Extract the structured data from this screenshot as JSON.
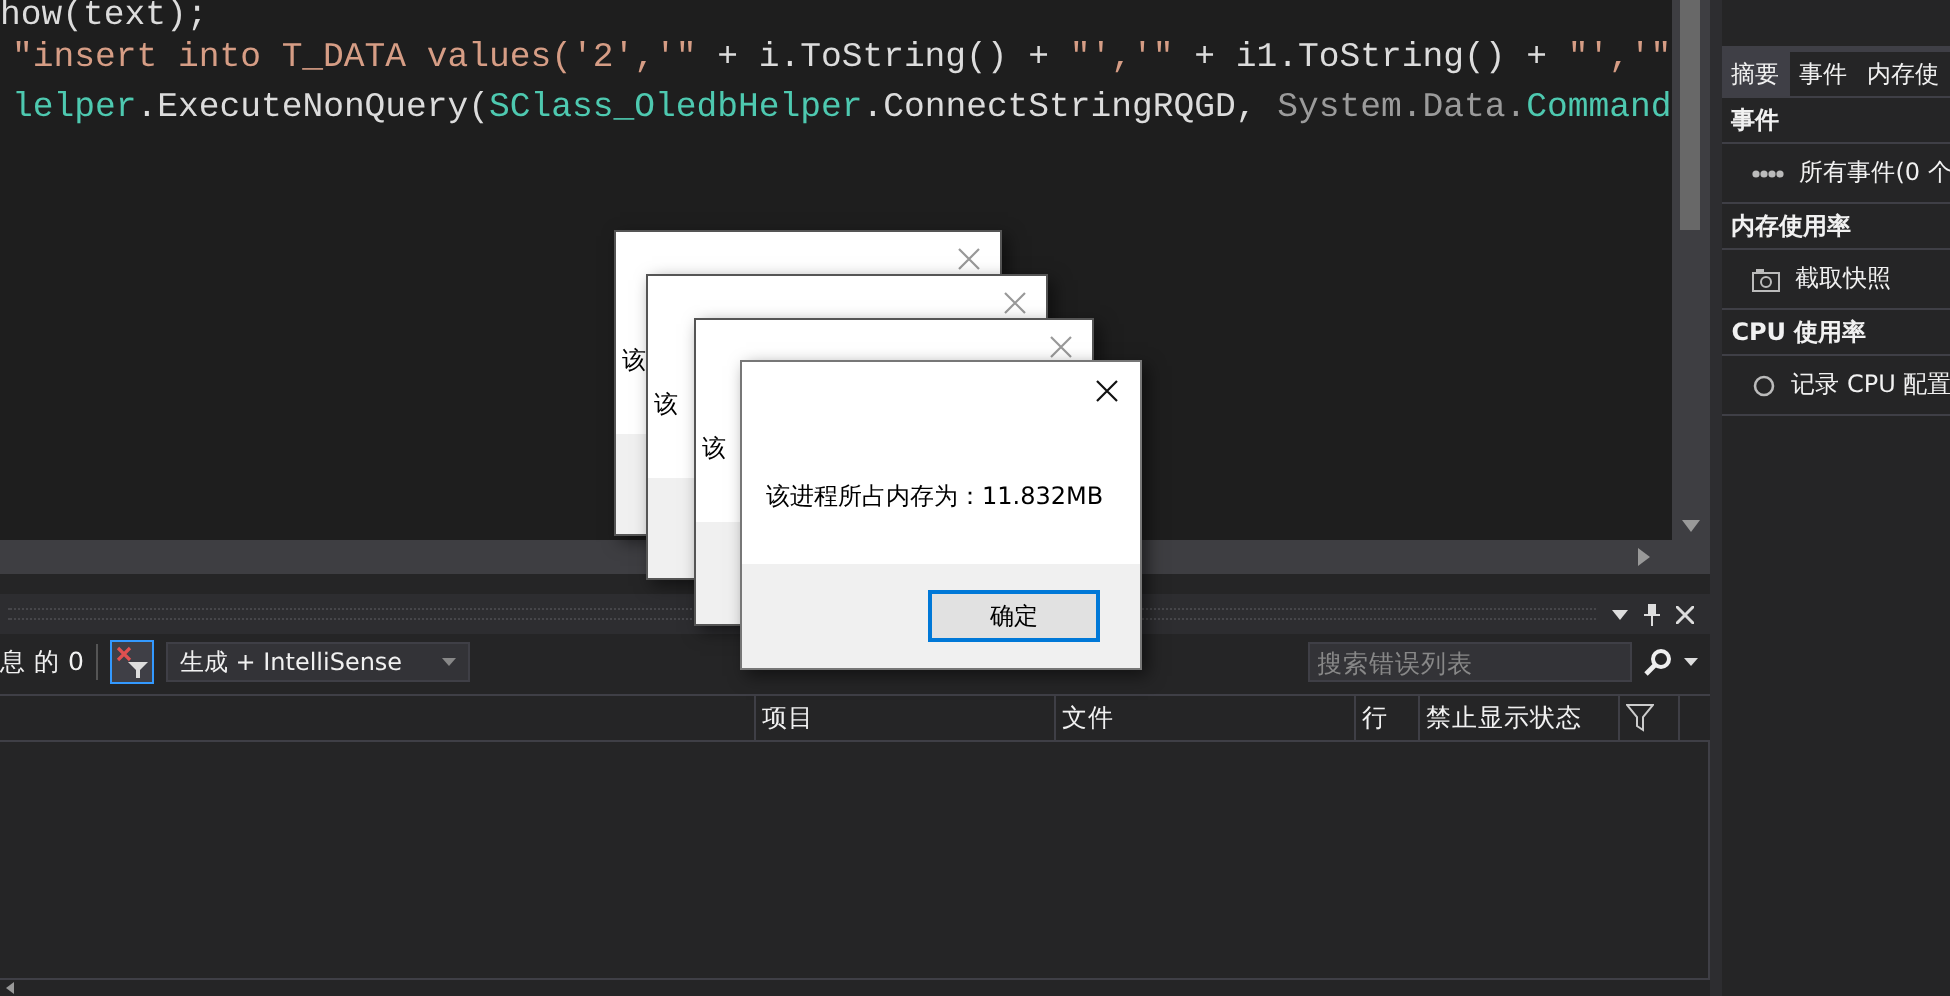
{
  "editor": {
    "lines": [
      {
        "tokens": [
          {
            "text": "how(text);",
            "kind": "plain"
          }
        ]
      },
      {
        "tokens": [
          {
            "text": "\"insert into T_DATA values('2','\"",
            "kind": "string"
          },
          {
            "text": " + i.ToString() + ",
            "kind": "plain"
          },
          {
            "text": "\"','\"",
            "kind": "string"
          },
          {
            "text": " + i1.ToString() + ",
            "kind": "plain"
          },
          {
            "text": "\"','\"",
            "kind": "string"
          }
        ]
      },
      {
        "tokens": [
          {
            "text": "lelper",
            "kind": "type"
          },
          {
            "text": ".ExecuteNonQuery(",
            "kind": "plain"
          },
          {
            "text": "SClass_OledbHelper",
            "kind": "type"
          },
          {
            "text": ".ConnectStringRQGD, ",
            "kind": "plain"
          },
          {
            "text": "System.Data.",
            "kind": "dim"
          },
          {
            "text": "Command",
            "kind": "type"
          }
        ]
      }
    ]
  },
  "error_list": {
    "message_count": "息 的 0",
    "filter_on": true,
    "scope": "生成 + IntelliSense",
    "search": {
      "placeholder": "搜索错误列表"
    },
    "columns": [
      "项目",
      "文件",
      "行",
      "禁止显示状态"
    ]
  },
  "diagnostics": {
    "tabs": [
      {
        "label": "摘要",
        "selected": true
      },
      {
        "label": "事件",
        "selected": false
      },
      {
        "label": "内存使",
        "selected": false
      }
    ],
    "sections": [
      {
        "title": "事件",
        "item": {
          "label": "所有事件(0 个"
        }
      },
      {
        "title": "内存使用率",
        "item": {
          "label": "截取快照"
        }
      },
      {
        "title": "CPU 使用率",
        "item": {
          "label": "记录 CPU 配置"
        }
      }
    ]
  },
  "dialogs": [
    {
      "message": "该"
    },
    {
      "message": "该"
    },
    {
      "message": "该"
    },
    {
      "message": "该进程所占内存为：11.832MB",
      "button": "确定"
    }
  ]
}
